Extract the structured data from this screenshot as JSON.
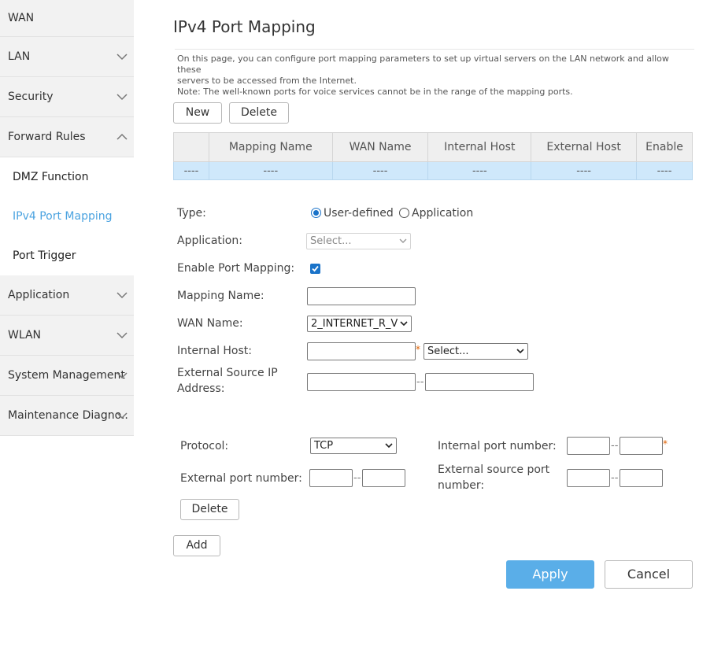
{
  "sidebar": {
    "items": [
      {
        "label": "WAN"
      },
      {
        "label": "LAN"
      },
      {
        "label": "Security"
      },
      {
        "label": "Forward Rules"
      },
      {
        "label": "DMZ Function"
      },
      {
        "label": "IPv4 Port Mapping"
      },
      {
        "label": "Port Trigger"
      },
      {
        "label": "Application"
      },
      {
        "label": "WLAN"
      },
      {
        "label": "System Management"
      },
      {
        "label": "Maintenance Diagno.."
      }
    ]
  },
  "page": {
    "title": "IPv4 Port Mapping",
    "desc_line1": "On this page, you can configure port mapping parameters to set up virtual servers on the LAN network and allow these",
    "desc_line2": "servers to be accessed from the Internet.",
    "desc_line3": "Note: The well-known ports for voice services cannot be in the range of the mapping ports."
  },
  "toolbar": {
    "new_label": "New",
    "delete_label": "Delete"
  },
  "table": {
    "headers": [
      "",
      "Mapping Name",
      "WAN Name",
      "Internal Host",
      "External Host",
      "Enable"
    ],
    "row": [
      "----",
      "----",
      "----",
      "----",
      "----",
      "----"
    ]
  },
  "form": {
    "type_label": "Type:",
    "type_option1": "User-defined",
    "type_option2": "Application",
    "application_label": "Application:",
    "application_value": "Select...",
    "enable_label": "Enable Port Mapping:",
    "mapping_name_label": "Mapping Name:",
    "wan_name_label": "WAN Name:",
    "wan_name_value": "2_INTERNET_R_V",
    "internal_host_label": "Internal Host:",
    "internal_host_select": "Select...",
    "ext_src_ip_label1": "External Source IP",
    "ext_src_ip_label2": "Address:",
    "dash": "--",
    "star": "*"
  },
  "ports": {
    "protocol_label": "Protocol:",
    "protocol_value": "TCP",
    "internal_port_label": "Internal port number:",
    "external_port_label": "External port number:",
    "ext_src_port_label1": "External source port",
    "ext_src_port_label2": "number:",
    "delete_label": "Delete"
  },
  "actions": {
    "add_label": "Add",
    "apply_label": "Apply",
    "cancel_label": "Cancel"
  },
  "colors": {
    "accent": "#5aaee8",
    "active_nav": "#4ba3e0",
    "row_highlight": "#cfe8fb"
  }
}
